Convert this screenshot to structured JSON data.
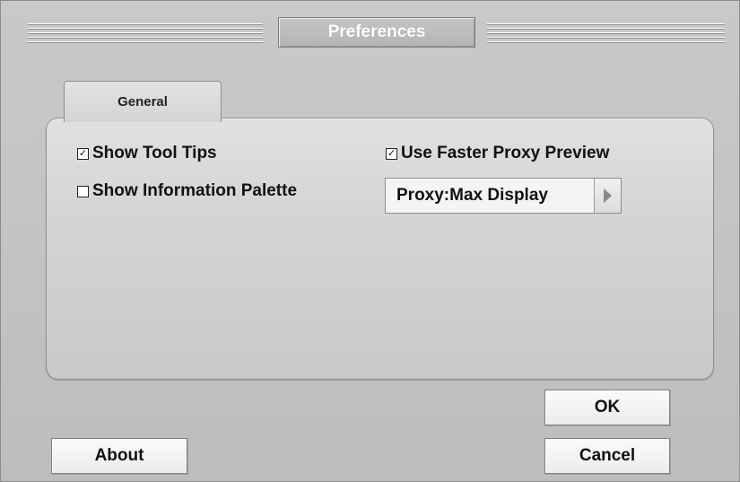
{
  "window": {
    "title": "Preferences"
  },
  "tabs": [
    {
      "label": "General",
      "selected": true
    }
  ],
  "general": {
    "show_tool_tips": {
      "label": "Show Tool Tips",
      "checked": true
    },
    "show_information_palette": {
      "label": "Show Information Palette",
      "checked": false
    },
    "use_faster_proxy_preview": {
      "label": "Use Faster Proxy Preview",
      "checked": true
    },
    "proxy_mode": {
      "selected": "Proxy:Max Display"
    }
  },
  "buttons": {
    "ok": "OK",
    "cancel": "Cancel",
    "about": "About"
  },
  "icons": {
    "checkmark": "checkmark-icon",
    "dropdown_arrow": "triangle-right-icon"
  }
}
